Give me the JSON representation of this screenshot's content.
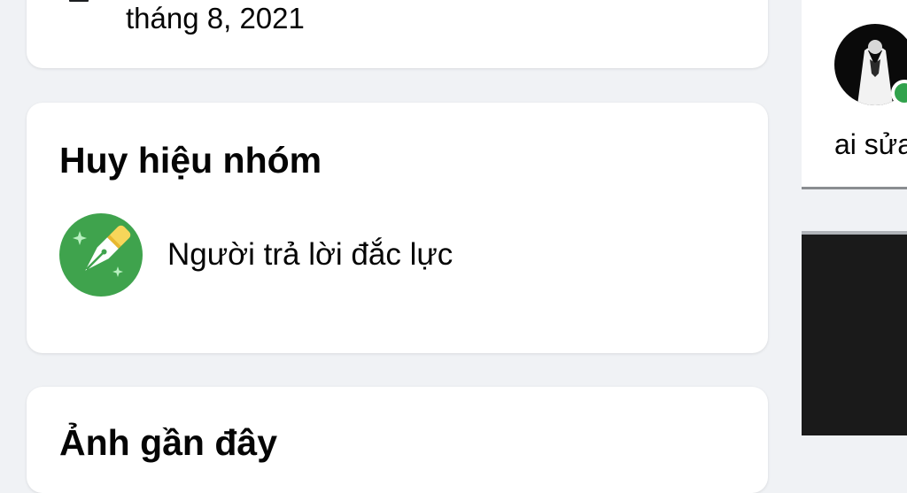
{
  "info_card": {
    "date_text": "tháng 8, 2021",
    "icon": "calendar-icon"
  },
  "badges_card": {
    "title": "Huy hiệu nhóm",
    "badge": {
      "label": "Người trả lời đắc lực",
      "icon": "fountain-pen-icon",
      "color": "#3fa34d"
    }
  },
  "photos_card": {
    "title": "Ảnh gần đây"
  },
  "right_column": {
    "member": {
      "name": "ai sửa",
      "avatar_icon": "tuxedo-avatar",
      "online_color": "#31a24c"
    }
  }
}
